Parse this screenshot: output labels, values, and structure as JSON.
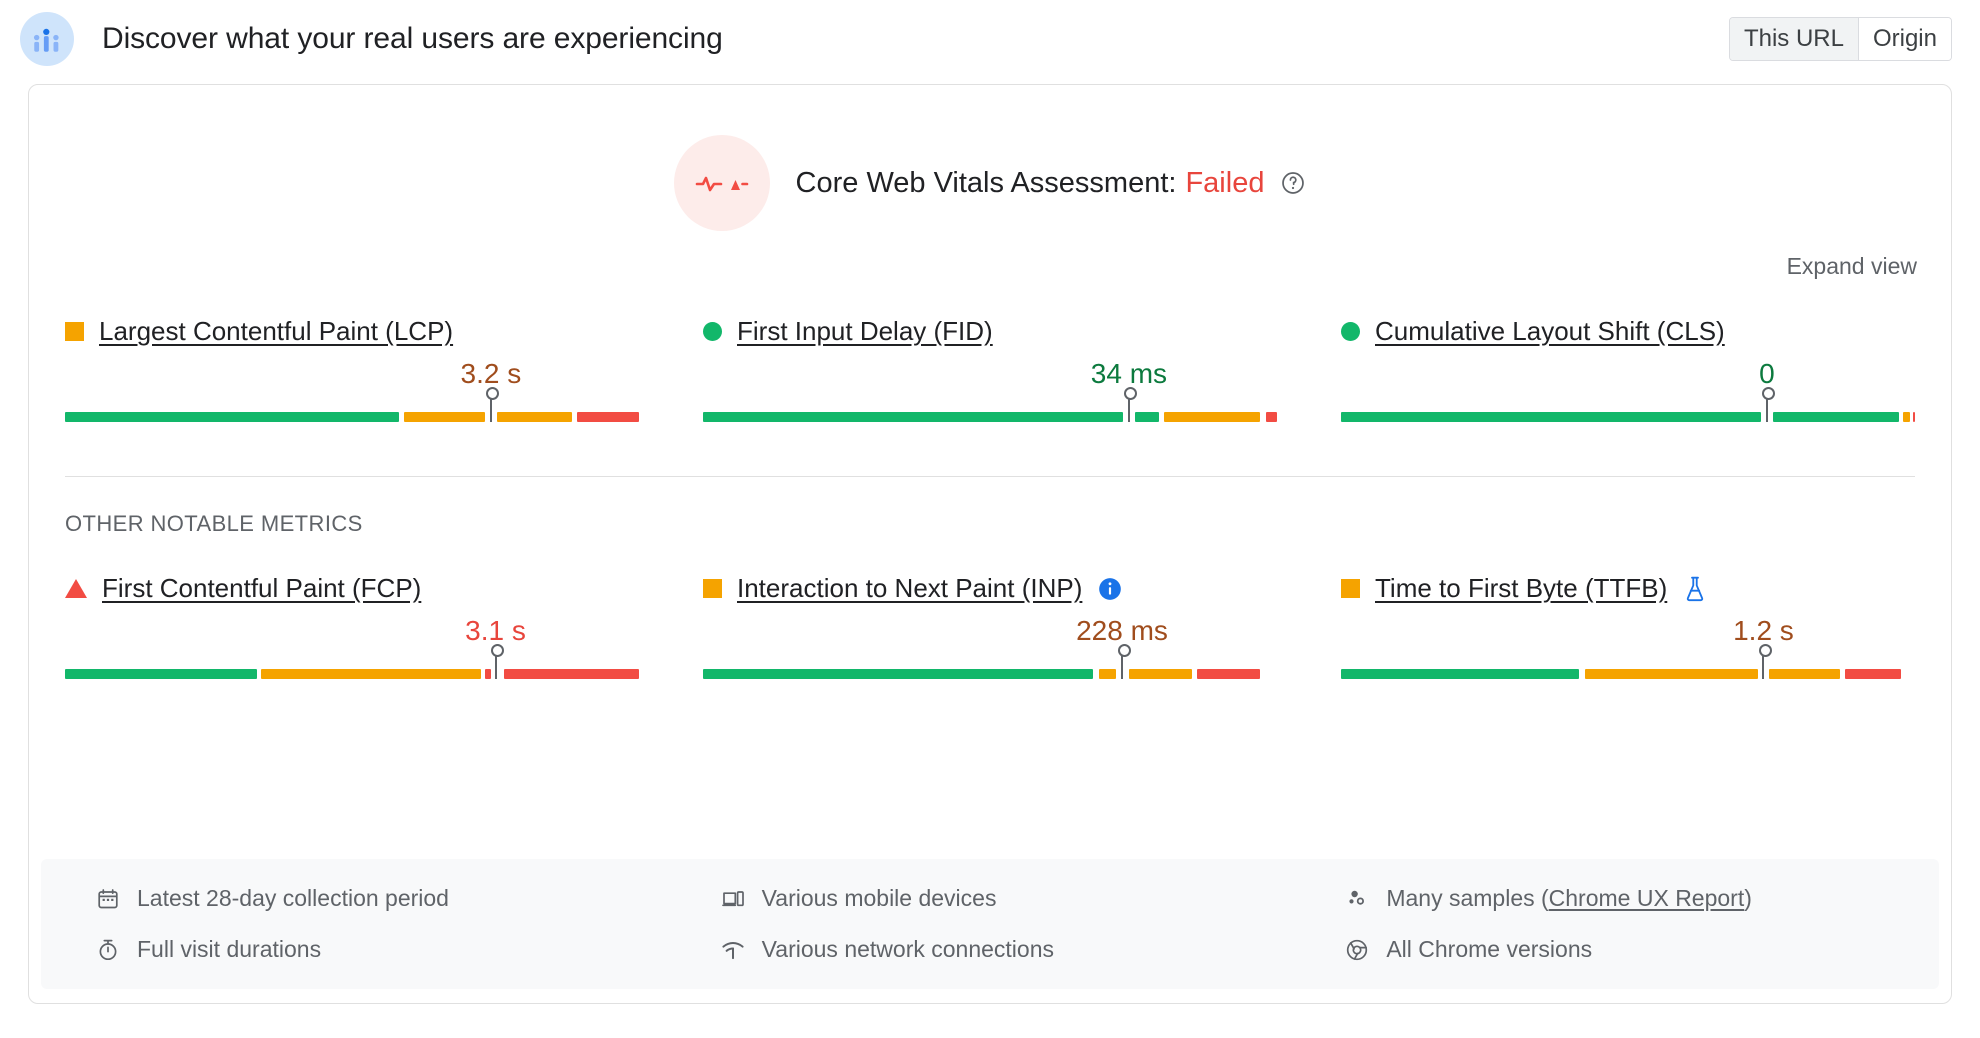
{
  "header": {
    "icon": "crux-users-icon",
    "title": "Discover what your real users are experiencing",
    "toggle": {
      "options": [
        "This URL",
        "Origin"
      ],
      "selected": "This URL"
    }
  },
  "assessment": {
    "badge_icon": "pulse-fail-icon",
    "label": "Core Web Vitals Assessment:",
    "verdict": "Failed",
    "verdict_color": "#e8453c",
    "help_icon": "help-circle-icon"
  },
  "expand_view": "Expand view",
  "section_label": "OTHER NOTABLE METRICS",
  "colors": {
    "good": "#12b76a",
    "average": "#f5a300",
    "poor": "#f24c43",
    "good_text": "#0c7a3e",
    "average_text": "#a04d1d",
    "poor_text": "#e8453c"
  },
  "core_metrics": [
    {
      "name": "Largest Contentful Paint (LCP)",
      "status": "average",
      "status_icon": "square-orange-icon",
      "value": "3.2 s",
      "value_class": "v-avg",
      "marker_pct": 74.2,
      "segments": [
        {
          "type": "good",
          "start": 0,
          "end": 58.2
        },
        {
          "type": "average",
          "start": 59.1,
          "end": 73.2
        },
        {
          "type": "average",
          "start": 75.3,
          "end": 88.3
        },
        {
          "type": "poor",
          "start": 89.2,
          "end": 100
        }
      ]
    },
    {
      "name": "First Input Delay (FID)",
      "status": "good",
      "status_icon": "circle-green-icon",
      "value": "34 ms",
      "value_class": "v-good",
      "marker_pct": 74.2,
      "segments": [
        {
          "type": "good",
          "start": 0,
          "end": 73.2
        },
        {
          "type": "good",
          "start": 75.3,
          "end": 79.4
        },
        {
          "type": "average",
          "start": 80.4,
          "end": 97.1
        },
        {
          "type": "poor",
          "start": 98.0,
          "end": 100
        }
      ]
    },
    {
      "name": "Cumulative Layout Shift (CLS)",
      "status": "good",
      "status_icon": "circle-green-icon",
      "value": "0",
      "value_class": "v-good",
      "marker_pct": 74.2,
      "segments": [
        {
          "type": "good",
          "start": 0,
          "end": 73.2
        },
        {
          "type": "good",
          "start": 75.3,
          "end": 97.2
        },
        {
          "type": "average",
          "start": 97.9,
          "end": 99.1
        },
        {
          "type": "poor",
          "start": 99.6,
          "end": 100
        }
      ]
    }
  ],
  "other_metrics": [
    {
      "name": "First Contentful Paint (FCP)",
      "status": "poor",
      "status_icon": "triangle-red-icon",
      "badge_icon": null,
      "value": "3.1 s",
      "value_class": "v-poor",
      "marker_pct": 75.0,
      "segments": [
        {
          "type": "good",
          "start": 0,
          "end": 33.5
        },
        {
          "type": "average",
          "start": 34.2,
          "end": 72.5
        },
        {
          "type": "poor",
          "start": 73.2,
          "end": 74.2
        },
        {
          "type": "poor",
          "start": 76.4,
          "end": 100
        }
      ]
    },
    {
      "name": "Interaction to Next Paint (INP)",
      "status": "average",
      "status_icon": "square-orange-icon",
      "badge_icon": "info-icon",
      "value": "228 ms",
      "value_class": "v-avg",
      "marker_pct": 73.0,
      "segments": [
        {
          "type": "good",
          "start": 0,
          "end": 68.0
        },
        {
          "type": "average",
          "start": 69.0,
          "end": 72.0
        },
        {
          "type": "average",
          "start": 74.2,
          "end": 85.2
        },
        {
          "type": "poor",
          "start": 86.0,
          "end": 97.0
        }
      ]
    },
    {
      "name": "Time to First Byte (TTFB)",
      "status": "average",
      "status_icon": "square-orange-icon",
      "badge_icon": "flask-experimental-icon",
      "value": "1.2 s",
      "value_class": "v-avg",
      "marker_pct": 73.6,
      "segments": [
        {
          "type": "good",
          "start": 0,
          "end": 41.5
        },
        {
          "type": "average",
          "start": 42.5,
          "end": 72.6
        },
        {
          "type": "average",
          "start": 74.5,
          "end": 87.0
        },
        {
          "type": "poor",
          "start": 87.8,
          "end": 97.5
        }
      ]
    }
  ],
  "footer": {
    "columns": [
      [
        {
          "icon": "calendar-icon",
          "text": "Latest 28-day collection period"
        },
        {
          "icon": "stopwatch-icon",
          "text": "Full visit durations"
        }
      ],
      [
        {
          "icon": "devices-icon",
          "text": "Various mobile devices"
        },
        {
          "icon": "network-icon",
          "text": "Various network connections"
        }
      ],
      [
        {
          "icon": "samples-icon",
          "text": "Many samples (",
          "link": "Chrome UX Report",
          "text_after": ")"
        },
        {
          "icon": "chrome-icon",
          "text": "All Chrome versions"
        }
      ]
    ]
  }
}
